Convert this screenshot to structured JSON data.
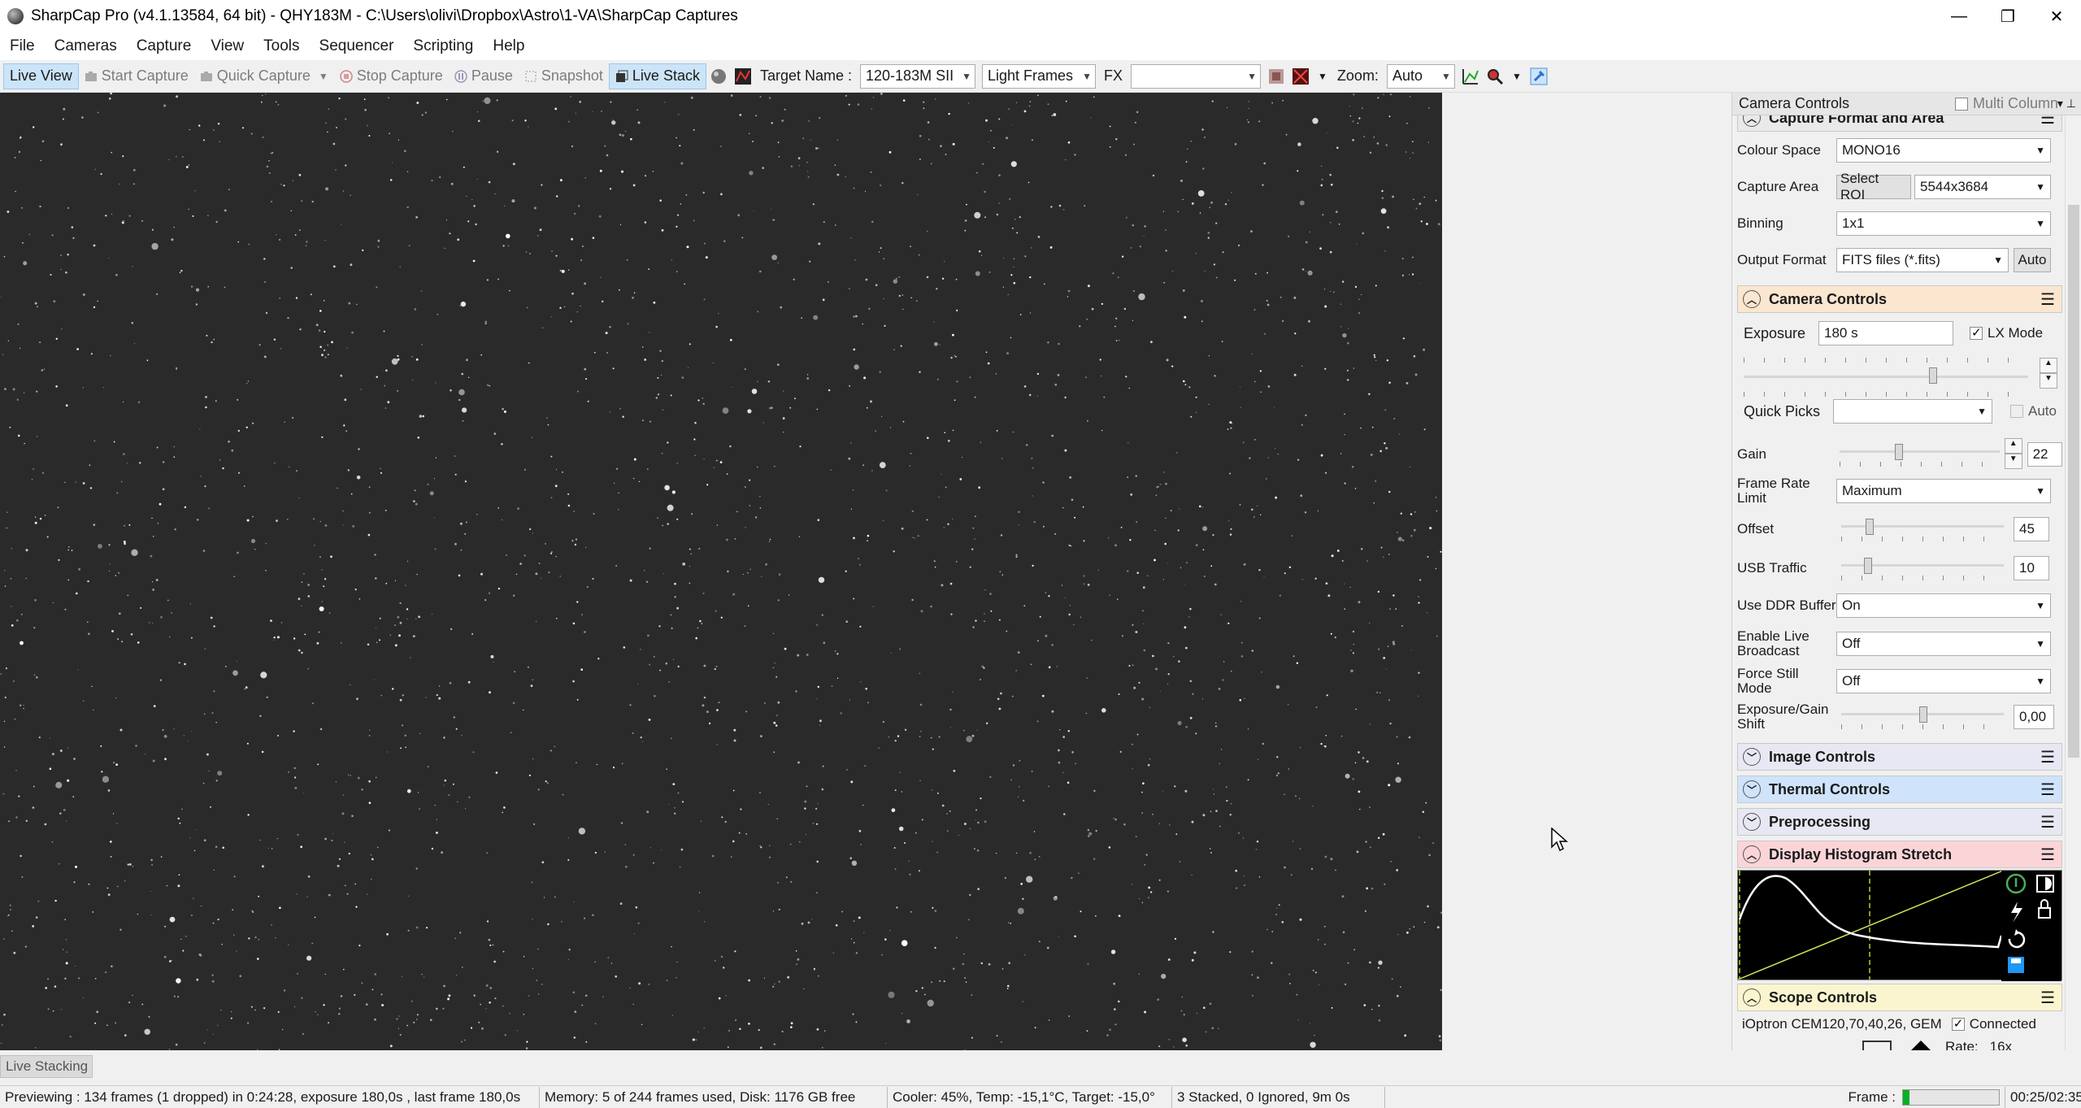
{
  "window": {
    "title": "SharpCap Pro (v4.1.13584, 64 bit) - QHY183M - C:\\Users\\olivi\\Dropbox\\Astro\\1-VA\\SharpCap Captures",
    "minimize": "—",
    "maximize": "❐",
    "close": "✕"
  },
  "menu": [
    "File",
    "Cameras",
    "Capture",
    "View",
    "Tools",
    "Sequencer",
    "Scripting",
    "Help"
  ],
  "toolbar": {
    "live_view": "Live View",
    "start_capture": "Start Capture",
    "quick_capture": "Quick Capture",
    "stop_capture": "Stop Capture",
    "pause": "Pause",
    "snapshot": "Snapshot",
    "live_stack": "Live Stack",
    "target_label": "Target Name :",
    "target_value": "120-183M SII",
    "frame_type": "Light Frames",
    "fx_label": "FX",
    "fx_value": "",
    "zoom_label": "Zoom:",
    "zoom_value": "Auto"
  },
  "panel": {
    "header": "Camera Controls",
    "multi_column": "Multi Column",
    "capture_format": {
      "title": "Capture Format and Area",
      "colour_space_label": "Colour Space",
      "colour_space": "MONO16",
      "capture_area_label": "Capture Area",
      "select_roi": "Select ROI",
      "capture_area": "5544x3684",
      "binning_label": "Binning",
      "binning": "1x1",
      "output_format_label": "Output Format",
      "output_format": "FITS files (*.fits)",
      "auto": "Auto"
    },
    "camera_controls": {
      "title": "Camera Controls",
      "exposure_label": "Exposure",
      "exposure": "180 s",
      "lx_mode": "LX Mode",
      "quick_picks_label": "Quick Picks",
      "quick_picks_auto": "Auto",
      "gain_label": "Gain",
      "gain": "22",
      "frame_rate_label": "Frame Rate Limit",
      "frame_rate": "Maximum",
      "offset_label": "Offset",
      "offset": "45",
      "usb_label": "USB Traffic",
      "usb": "10",
      "ddr_label": "Use DDR Buffer",
      "ddr": "On",
      "broadcast_label": "Enable Live Broadcast",
      "broadcast": "Off",
      "still_label": "Force Still Mode",
      "still": "Off",
      "shift_label": "Exposure/Gain Shift",
      "shift": "0,00"
    },
    "groups": {
      "image_controls": "Image Controls",
      "thermal_controls": "Thermal Controls",
      "preprocessing": "Preprocessing",
      "histogram": "Display Histogram Stretch",
      "scope": "Scope Controls"
    },
    "scope": {
      "mount": "iOptron CEM120,70,40,26, GEM",
      "connected": "Connected",
      "rate": "Rate:",
      "rate_value": "16x"
    }
  },
  "bottom": {
    "live_stacking_tab": "Live Stacking",
    "status_preview": "Previewing : 134 frames (1 dropped) in 0:24:28, exposure 180,0s , last frame 180,0s",
    "status_memory": "Memory: 5 of 244 frames used, Disk: 1176 GB free",
    "status_cooler": "Cooler: 45%, Temp: -15,1°C, Target: -15,0°",
    "status_stack": "3 Stacked, 0 Ignored, 9m 0s",
    "frame_label": "Frame :",
    "frame_progress": 0.07,
    "time": "00:25/02:35"
  },
  "colors": {
    "camera_controls_head": "#fbe6cf",
    "thermal_head": "#cfe3fb",
    "histogram_head": "#fbd4d8",
    "scope_head": "#fbf5cf",
    "image_head": "#e8e8f4"
  }
}
